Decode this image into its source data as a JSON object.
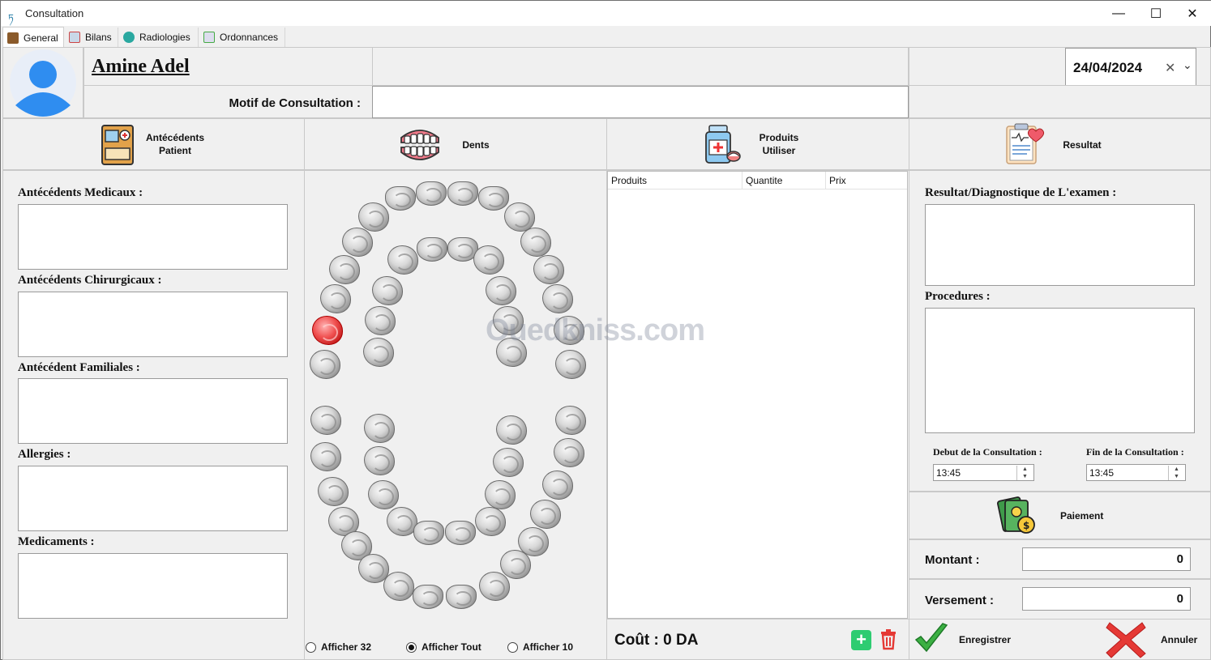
{
  "window": {
    "title": "Consultation",
    "minimize": "—",
    "maximize": "☐",
    "close": "✕"
  },
  "tabs": [
    {
      "label": "General",
      "icon": "general-icon",
      "active": true
    },
    {
      "label": "Bilans",
      "icon": "bilans-icon"
    },
    {
      "label": "Radiologies",
      "icon": "radiologies-icon"
    },
    {
      "label": "Ordonnances",
      "icon": "ordonnances-icon"
    }
  ],
  "patient": {
    "name": "Amine Adel",
    "motif_label": "Motif de Consultation :",
    "motif_value": ""
  },
  "date": {
    "value": "24/04/2024",
    "clear": "✕",
    "dropdown": "⌄"
  },
  "sections": {
    "antecedents_title": "Antécédents\nPatient",
    "dents_title": "Dents",
    "produits_title": "Produits\nUtiliser",
    "resultat_title": "Resultat"
  },
  "antecedents": {
    "medicaux": "Antécédents Medicaux :",
    "chirurgicaux": "Antécédents Chirurgicaux :",
    "familiales": "Antécédent Familiales :",
    "allergies": "Allergies :",
    "medicaments": "Medicaments :"
  },
  "produits_table": {
    "columns": [
      "Produits",
      "Quantite",
      "Prix"
    ],
    "rows": []
  },
  "cout": "Coût : 0 DA",
  "resultat": {
    "diagnostic_label": "Resultat/Diagnostique de L'examen :",
    "procedures_label": "Procedures :",
    "debut_label": "Debut de la Consultation :",
    "fin_label": "Fin de la Consultation :",
    "debut_value": "13:45",
    "fin_value": "13:45"
  },
  "paiement": {
    "title": "Paiement",
    "montant_label": "Montant :",
    "montant_value": "0",
    "versement_label": "Versement :",
    "versement_value": "0"
  },
  "actions": {
    "save": "Enregistrer",
    "cancel": "Annuler"
  },
  "teeth_view": {
    "options": [
      "Afficher 32",
      "Afficher Tout",
      "Afficher 10"
    ],
    "selected": "Afficher Tout"
  },
  "watermark": "Ouedkniss.com",
  "colors": {
    "accent_red": "#e53935",
    "check_green": "#3cb043",
    "add_green": "#2ecc71",
    "delete_red": "#e53935"
  }
}
